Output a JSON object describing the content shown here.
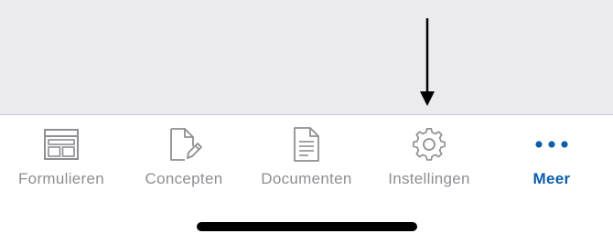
{
  "colors": {
    "inactive": "#8e8e93",
    "active": "#0b5ea8",
    "content_bg": "#ebeaef",
    "separator": "#c9c8cd"
  },
  "tabbar": {
    "tabs": [
      {
        "label": "Formulieren",
        "icon": "forms-icon",
        "active": false
      },
      {
        "label": "Concepten",
        "icon": "draft-edit-icon",
        "active": false
      },
      {
        "label": "Documenten",
        "icon": "document-icon",
        "active": false
      },
      {
        "label": "Instellingen",
        "icon": "gear-icon",
        "active": false
      },
      {
        "label": "Meer",
        "icon": "more-dots-icon",
        "active": true
      }
    ]
  }
}
